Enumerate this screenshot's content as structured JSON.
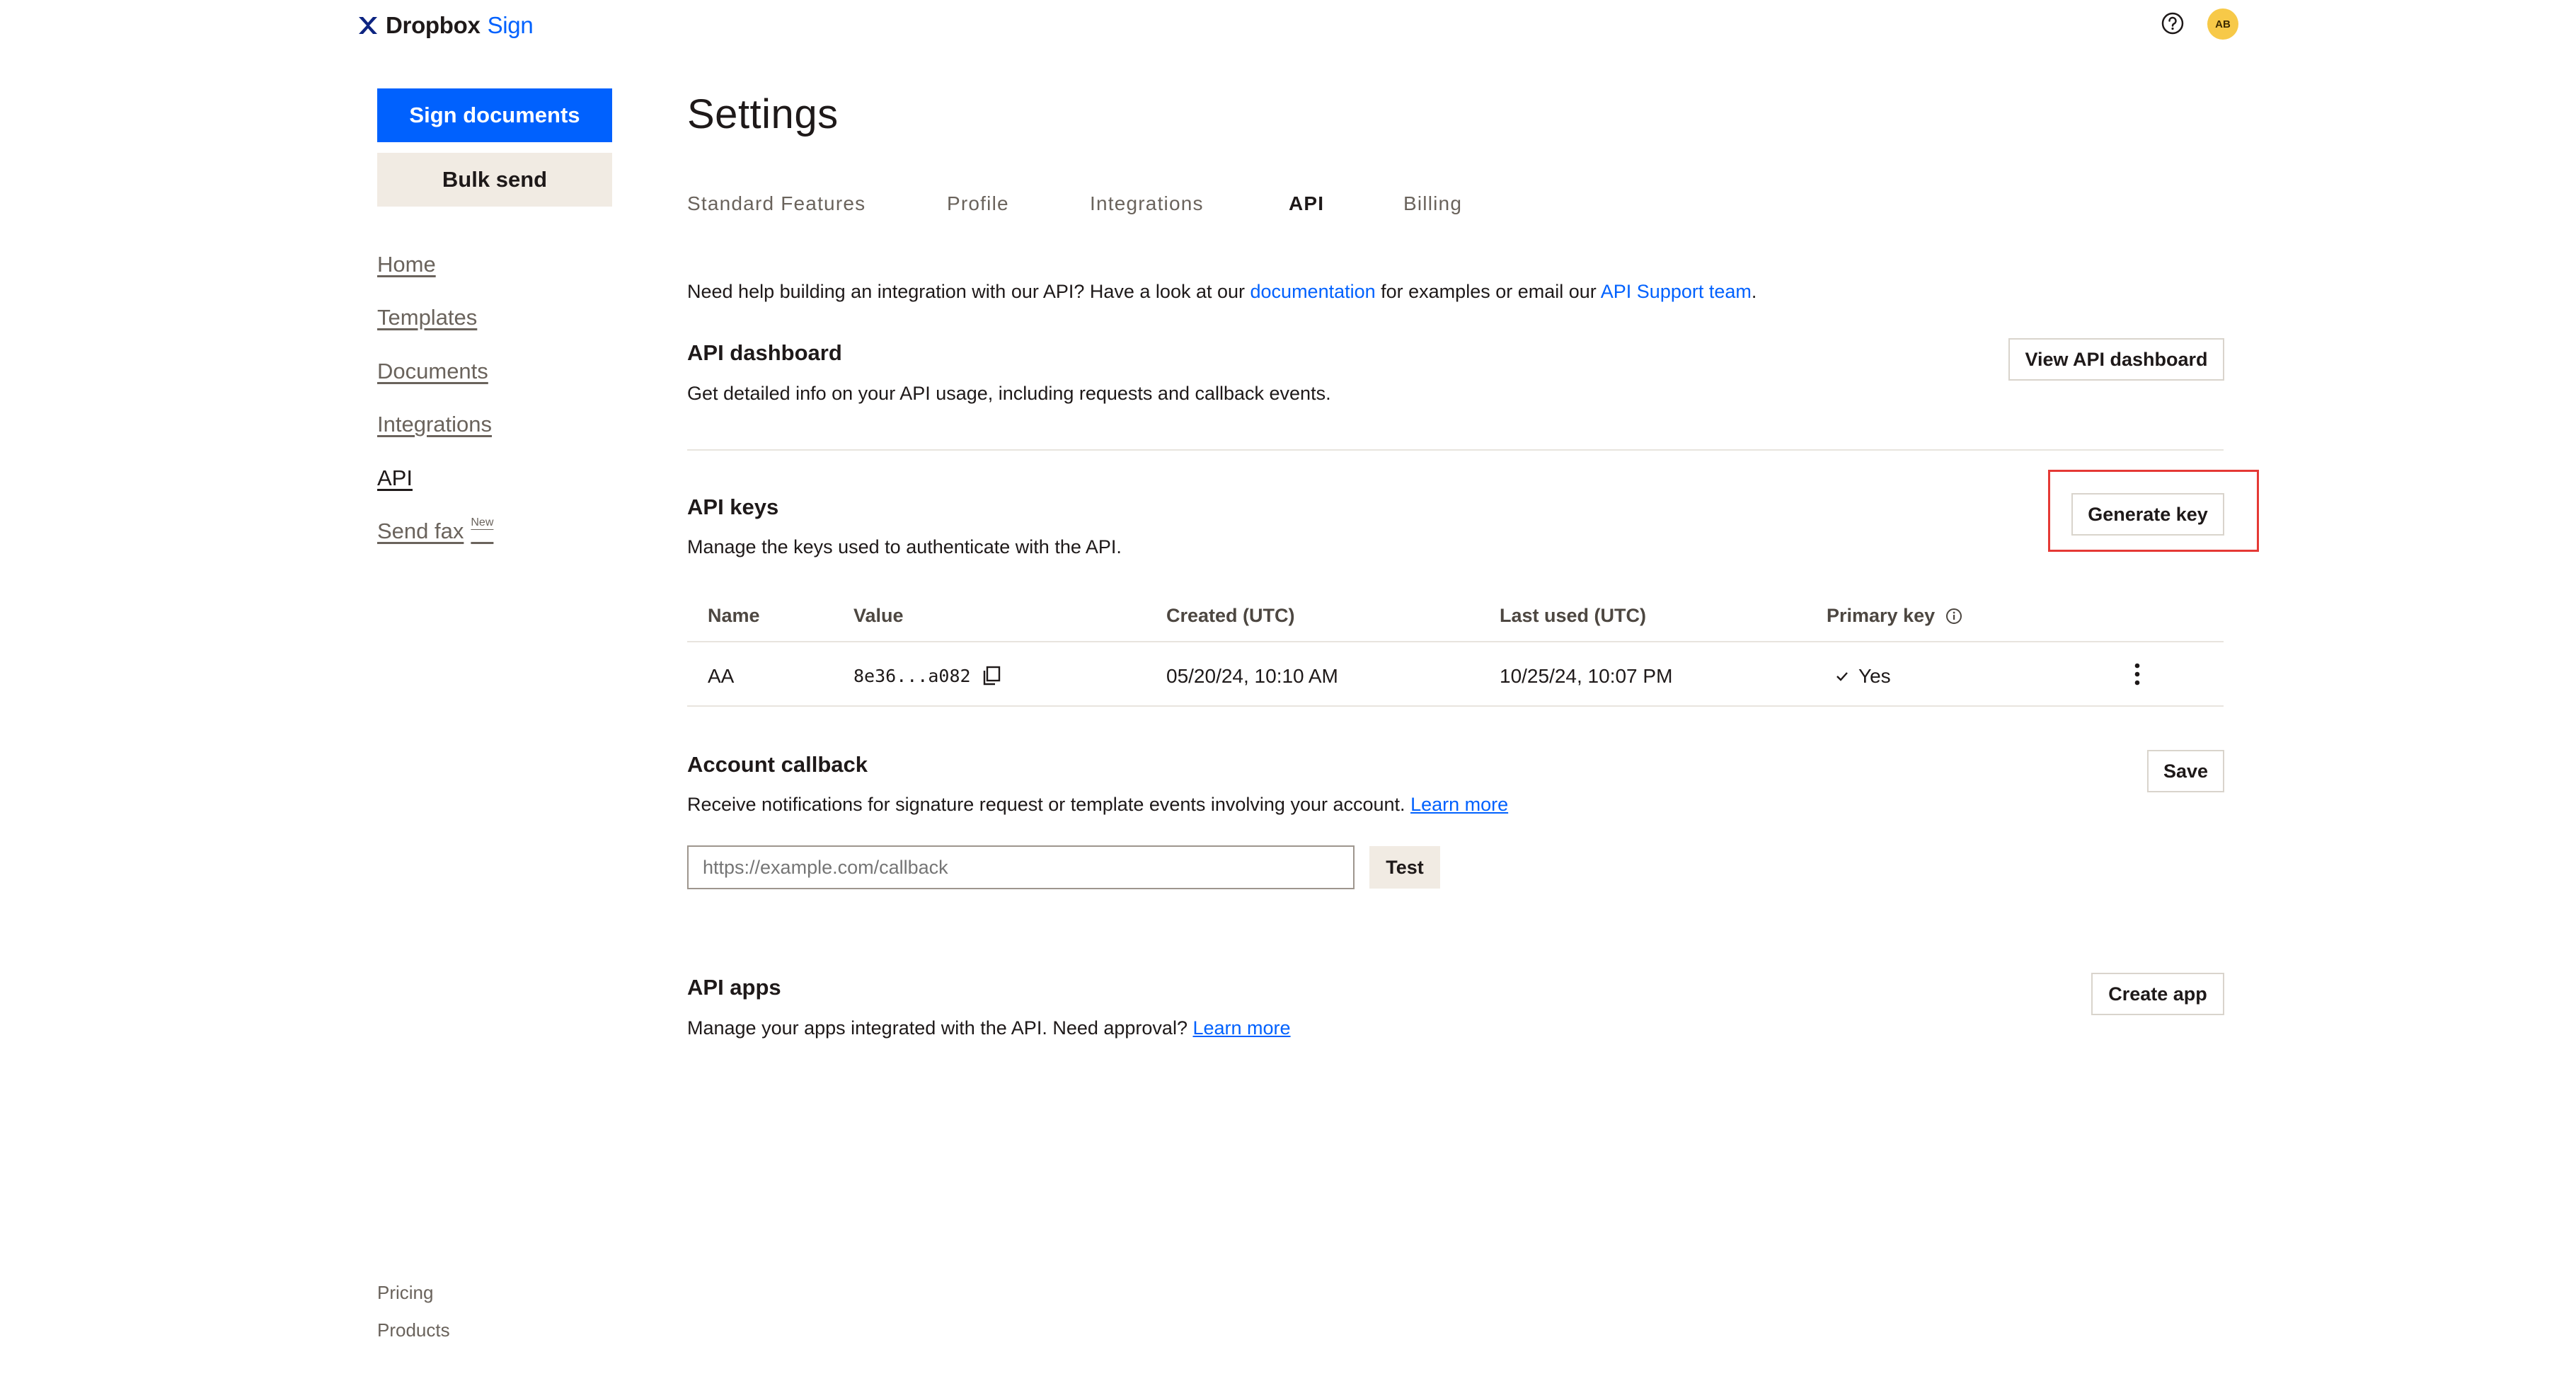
{
  "header": {
    "logo_word": "Dropbox",
    "logo_sign": "Sign",
    "avatar_initials": "AB"
  },
  "sidebar": {
    "sign_documents": "Sign documents",
    "bulk_send": "Bulk send",
    "nav": [
      {
        "label": "Home"
      },
      {
        "label": "Templates"
      },
      {
        "label": "Documents"
      },
      {
        "label": "Integrations"
      },
      {
        "label": "API"
      },
      {
        "label": "Send fax",
        "badge": "New"
      }
    ],
    "footer": [
      "Pricing",
      "Products"
    ]
  },
  "main": {
    "title": "Settings",
    "tabs": [
      "Standard Features",
      "Profile",
      "Integrations",
      "API",
      "Billing"
    ],
    "active_tab": "API",
    "help": {
      "prefix": "Need help building an integration with our API? Have a look at our ",
      "doc_link": "documentation",
      "middle": " for examples or email our ",
      "support_link": "API Support team",
      "suffix": "."
    },
    "api_dashboard": {
      "title": "API dashboard",
      "description": "Get detailed info on your API usage, including requests and callback events.",
      "button": "View API dashboard"
    },
    "api_keys": {
      "title": "API keys",
      "description": "Manage the keys used to authenticate with the API.",
      "button": "Generate key",
      "columns": [
        "Name",
        "Value",
        "Created (UTC)",
        "Last used (UTC)",
        "Primary key"
      ],
      "rows": [
        {
          "name": "AA",
          "value": "8e36...a082",
          "created": "05/20/24, 10:10 AM",
          "last_used": "10/25/24, 10:07 PM",
          "primary": "Yes"
        }
      ]
    },
    "account_callback": {
      "title": "Account callback",
      "description": "Receive notifications for signature request or template events involving your account.",
      "learn_more": "Learn more",
      "save": "Save",
      "input_placeholder": "https://example.com/callback",
      "input_value": "",
      "test": "Test"
    },
    "api_apps": {
      "title": "API apps",
      "description": "Manage your apps integrated with the API. Need approval?",
      "learn_more": "Learn more",
      "button": "Create app"
    }
  },
  "colors": {
    "accent": "#0061fe",
    "secondary_button": "#f1ebe3",
    "avatar": "#f7c948",
    "highlight": "#e53935"
  }
}
